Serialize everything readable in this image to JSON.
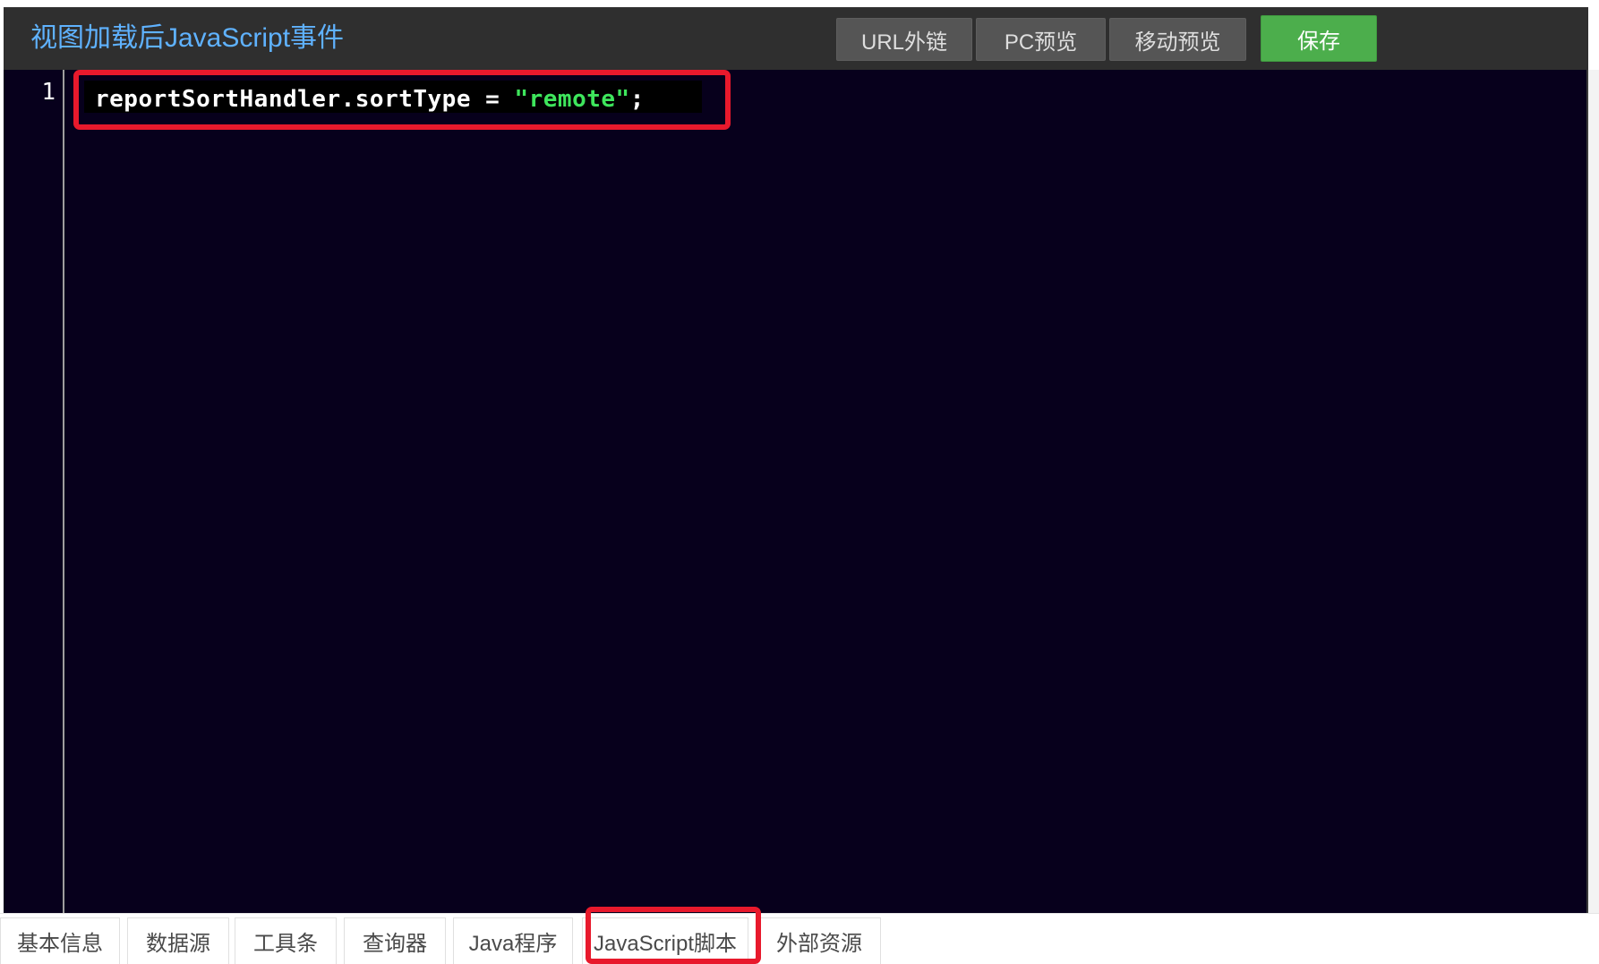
{
  "header": {
    "title": "视图加载后JavaScript事件",
    "buttons": {
      "url_link": "URL外链",
      "pc_preview": "PC预览",
      "mobile_preview": "移动预览",
      "save": "保存"
    }
  },
  "editor": {
    "lines": [
      {
        "number": "1",
        "code_prefix": "reportSortHandler.sortType = ",
        "code_string": "\"remote\"",
        "code_suffix": ";"
      }
    ]
  },
  "tabs": [
    {
      "label": "基本信息"
    },
    {
      "label": "数据源"
    },
    {
      "label": "工具条"
    },
    {
      "label": "查询器"
    },
    {
      "label": "Java程序"
    },
    {
      "label": "JavaScript脚本",
      "active": true
    },
    {
      "label": "外部资源"
    }
  ],
  "colors": {
    "title": "#5fb2ff",
    "editor_bg": "#07001c",
    "string": "#3ee65c",
    "save_button": "#4cae4c",
    "highlight_border": "#e8192c"
  }
}
